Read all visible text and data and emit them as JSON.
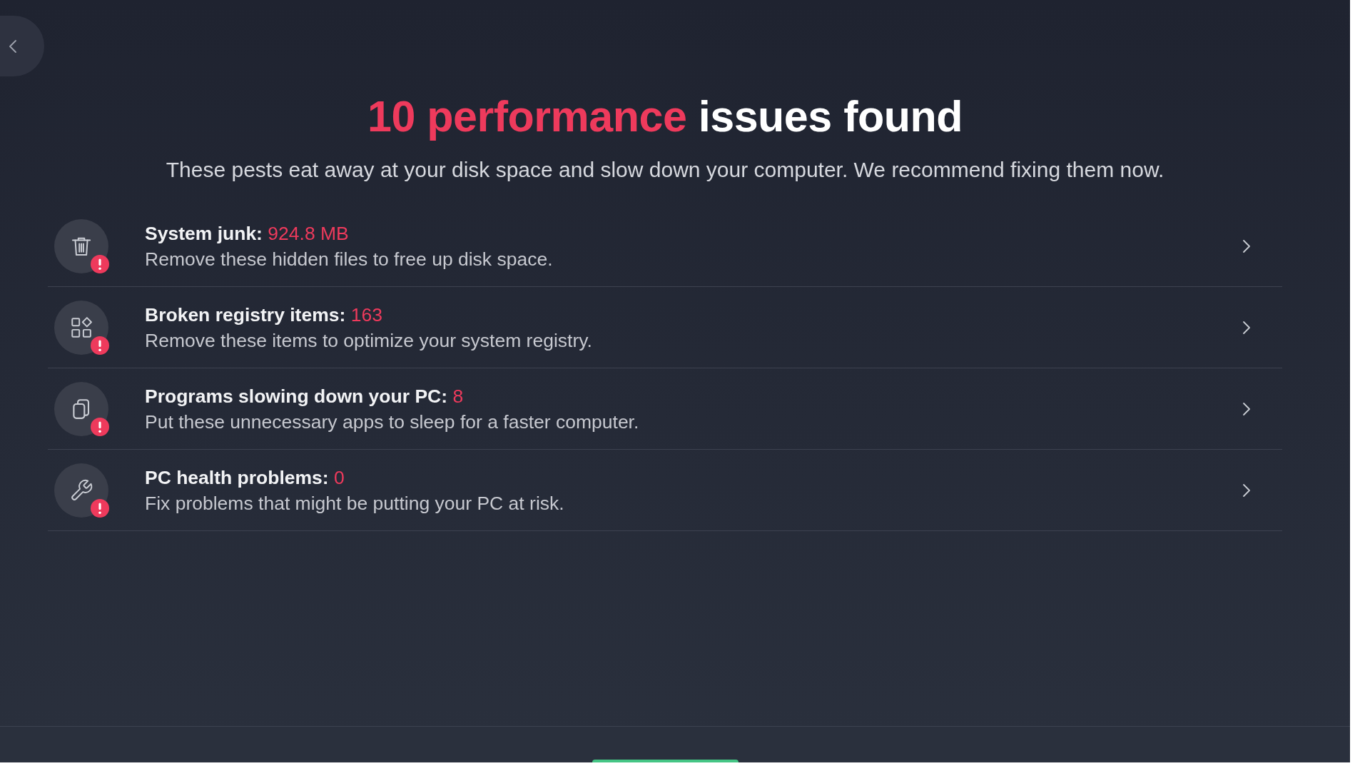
{
  "title": {
    "highlight": "10 performance",
    "text": "issues found"
  },
  "subtitle": "These pests eat away at your disk space and slow down your computer. We recommend fixing them now.",
  "issues": [
    {
      "kind": "junk",
      "label": "System junk:",
      "value": "924.8 MB",
      "description": "Remove these hidden files to free up disk space.",
      "alert": true
    },
    {
      "kind": "registry",
      "label": "Broken registry items:",
      "value": "163",
      "description": "Remove these items to optimize your system registry.",
      "alert": true
    },
    {
      "kind": "programs",
      "label": "Programs slowing down your PC:",
      "value": "8",
      "description": "Put these unnecessary apps to sleep for a faster computer.",
      "alert": true
    },
    {
      "kind": "health",
      "label": "PC health problems:",
      "value": "0",
      "description": "Fix problems that might be putting your PC at risk.",
      "alert": true
    }
  ]
}
